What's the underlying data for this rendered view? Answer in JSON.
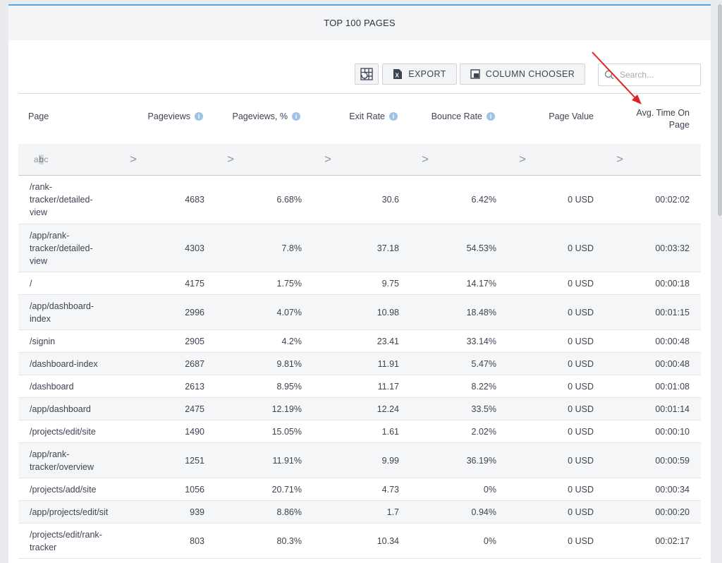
{
  "header": {
    "title": "TOP 100 PAGES"
  },
  "toolbar": {
    "export_label": "EXPORT",
    "column_chooser_label": "COLUMN CHOOSER",
    "search_placeholder": "Search..."
  },
  "columns": [
    "Page",
    "Pageviews",
    "Pageviews, %",
    "Exit Rate",
    "Bounce Rate",
    "Page Value",
    "Avg. Time On Page"
  ],
  "filter": {
    "text_hint": "abc",
    "operator": ">"
  },
  "rows": [
    {
      "page": "/rank-tracker/detailed-view",
      "pageviews": "4683",
      "pageviews_pct": "6.68%",
      "exit_rate": "30.6",
      "bounce_rate": "6.42%",
      "page_value": "0 USD",
      "avg_time": "00:02:02"
    },
    {
      "page": "/app/rank-tracker/detailed-view",
      "pageviews": "4303",
      "pageviews_pct": "7.8%",
      "exit_rate": "37.18",
      "bounce_rate": "54.53%",
      "page_value": "0 USD",
      "avg_time": "00:03:32"
    },
    {
      "page": "/",
      "pageviews": "4175",
      "pageviews_pct": "1.75%",
      "exit_rate": "9.75",
      "bounce_rate": "14.17%",
      "page_value": "0 USD",
      "avg_time": "00:00:18"
    },
    {
      "page": "/app/dashboard-index",
      "pageviews": "2996",
      "pageviews_pct": "4.07%",
      "exit_rate": "10.98",
      "bounce_rate": "18.48%",
      "page_value": "0 USD",
      "avg_time": "00:01:15"
    },
    {
      "page": "/signin",
      "pageviews": "2905",
      "pageviews_pct": "4.2%",
      "exit_rate": "23.41",
      "bounce_rate": "33.14%",
      "page_value": "0 USD",
      "avg_time": "00:00:48"
    },
    {
      "page": "/dashboard-index",
      "pageviews": "2687",
      "pageviews_pct": "9.81%",
      "exit_rate": "11.91",
      "bounce_rate": "5.47%",
      "page_value": "0 USD",
      "avg_time": "00:00:48"
    },
    {
      "page": "/dashboard",
      "pageviews": "2613",
      "pageviews_pct": "8.95%",
      "exit_rate": "11.17",
      "bounce_rate": "8.22%",
      "page_value": "0 USD",
      "avg_time": "00:01:08"
    },
    {
      "page": "/app/dashboard",
      "pageviews": "2475",
      "pageviews_pct": "12.19%",
      "exit_rate": "12.24",
      "bounce_rate": "33.5%",
      "page_value": "0 USD",
      "avg_time": "00:01:14"
    },
    {
      "page": "/projects/edit/site",
      "pageviews": "1490",
      "pageviews_pct": "15.05%",
      "exit_rate": "1.61",
      "bounce_rate": "2.02%",
      "page_value": "0 USD",
      "avg_time": "00:00:10"
    },
    {
      "page": "/app/rank-tracker/overview",
      "pageviews": "1251",
      "pageviews_pct": "11.91%",
      "exit_rate": "9.99",
      "bounce_rate": "36.19%",
      "page_value": "0 USD",
      "avg_time": "00:00:59"
    },
    {
      "page": "/projects/add/site",
      "pageviews": "1056",
      "pageviews_pct": "20.71%",
      "exit_rate": "4.73",
      "bounce_rate": "0%",
      "page_value": "0 USD",
      "avg_time": "00:00:34"
    },
    {
      "page": "/app/projects/edit/sit",
      "pageviews": "939",
      "pageviews_pct": "8.86%",
      "exit_rate": "1.7",
      "bounce_rate": "0.94%",
      "page_value": "0 USD",
      "avg_time": "00:00:20"
    },
    {
      "page": "/projects/edit/rank-tracker",
      "pageviews": "803",
      "pageviews_pct": "80.3%",
      "exit_rate": "10.34",
      "bounce_rate": "0%",
      "page_value": "0 USD",
      "avg_time": "00:02:17"
    }
  ],
  "colors": {
    "accent": "#59a3e0",
    "info_icon": "#9fc3e6",
    "annotation_arrow": "#e02424"
  }
}
